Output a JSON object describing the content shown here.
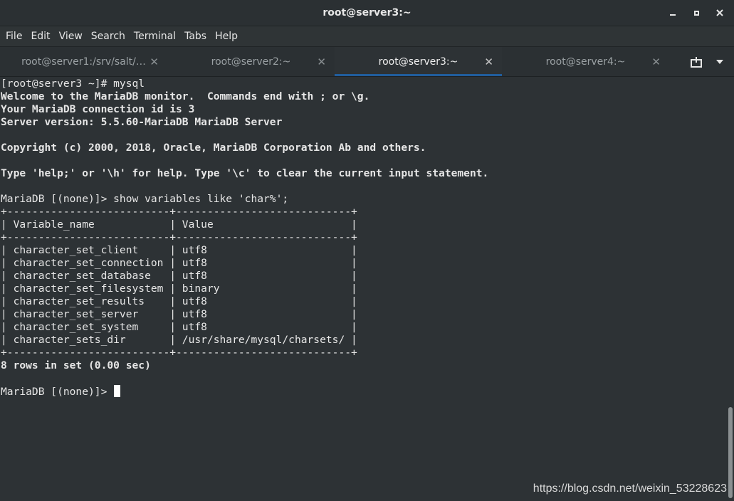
{
  "window": {
    "title": "root@server3:~"
  },
  "menubar": [
    "File",
    "Edit",
    "View",
    "Search",
    "Terminal",
    "Tabs",
    "Help"
  ],
  "tabs": [
    {
      "label": "root@server1:/srv/salt/…",
      "active": false
    },
    {
      "label": "root@server2:~",
      "active": false
    },
    {
      "label": "root@server3:~",
      "active": true
    },
    {
      "label": "root@server4:~",
      "active": false
    }
  ],
  "terminal": {
    "lines": [
      {
        "text": "[root@server3 ~]# mysql",
        "bold": false
      },
      {
        "text": "Welcome to the MariaDB monitor.  Commands end with ; or \\g.",
        "bold": true
      },
      {
        "text": "Your MariaDB connection id is 3",
        "bold": true
      },
      {
        "text": "Server version: 5.5.60-MariaDB MariaDB Server",
        "bold": true
      },
      {
        "text": "",
        "bold": false
      },
      {
        "text": "Copyright (c) 2000, 2018, Oracle, MariaDB Corporation Ab and others.",
        "bold": true
      },
      {
        "text": "",
        "bold": false
      },
      {
        "text": "Type 'help;' or '\\h' for help. Type '\\c' to clear the current input statement.",
        "bold": true
      },
      {
        "text": "",
        "bold": false
      },
      {
        "text": "MariaDB [(none)]> show variables like 'char%';",
        "bold": false
      },
      {
        "text": "+--------------------------+----------------------------+",
        "bold": false
      },
      {
        "text": "| Variable_name            | Value                      |",
        "bold": false
      },
      {
        "text": "+--------------------------+----------------------------+",
        "bold": false
      },
      {
        "text": "| character_set_client     | utf8                       |",
        "bold": false
      },
      {
        "text": "| character_set_connection | utf8                       |",
        "bold": false
      },
      {
        "text": "| character_set_database   | utf8                       |",
        "bold": false
      },
      {
        "text": "| character_set_filesystem | binary                     |",
        "bold": false
      },
      {
        "text": "| character_set_results    | utf8                       |",
        "bold": false
      },
      {
        "text": "| character_set_server     | utf8                       |",
        "bold": false
      },
      {
        "text": "| character_set_system     | utf8                       |",
        "bold": false
      },
      {
        "text": "| character_sets_dir       | /usr/share/mysql/charsets/ |",
        "bold": false
      },
      {
        "text": "+--------------------------+----------------------------+",
        "bold": false
      },
      {
        "text": "8 rows in set (0.00 sec)",
        "bold": true
      },
      {
        "text": "",
        "bold": false
      }
    ],
    "prompt": "MariaDB [(none)]> "
  },
  "watermark": "https://blog.csdn.net/weixin_53228623",
  "colors": {
    "accent": "#215d9c",
    "background": "#2d3235",
    "foreground": "#e6e6e6"
  }
}
